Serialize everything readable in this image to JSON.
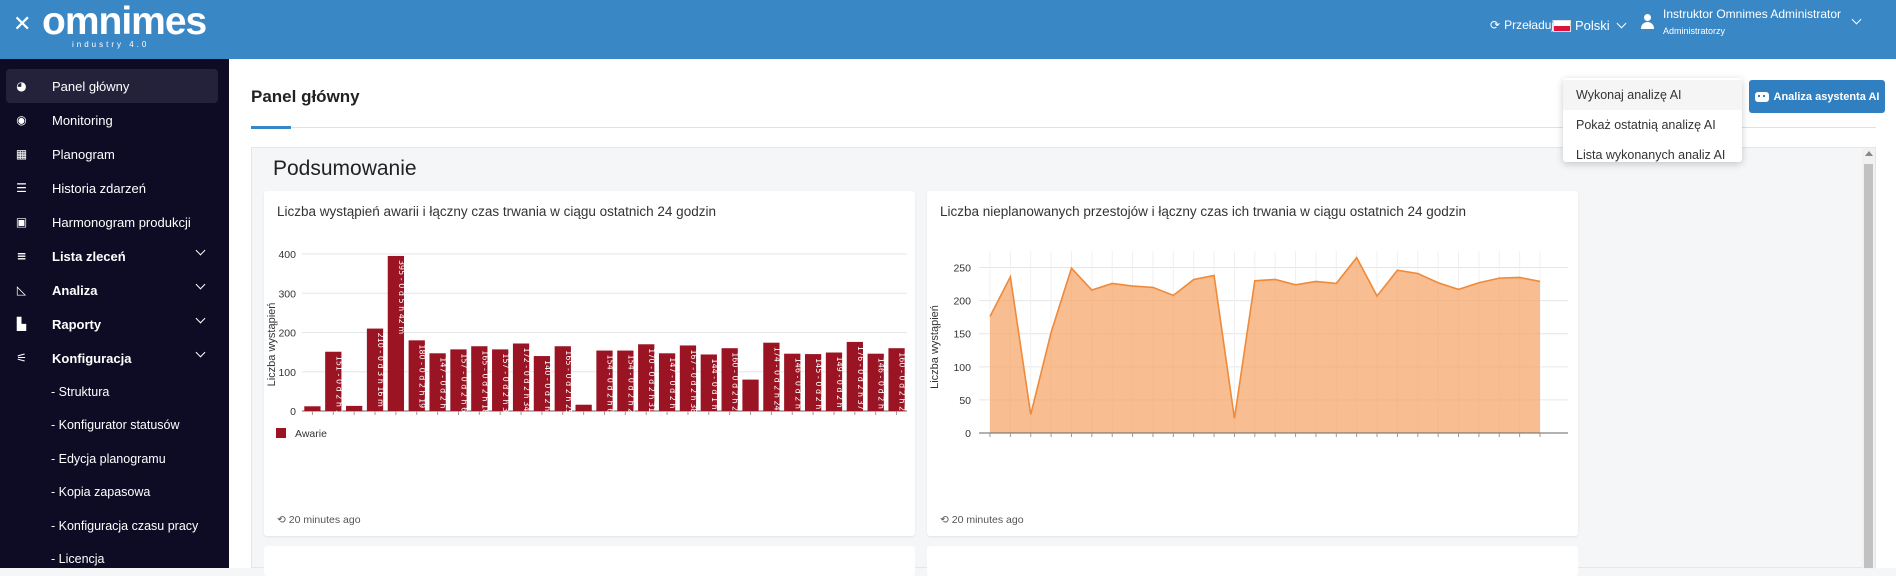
{
  "header": {
    "close_icon": "close-icon",
    "logo": "omnimes",
    "logo_tagline": "industry 4.0",
    "reload_label": "Przeładuj",
    "language": "Polski",
    "user_name": "Instruktor Omnimes Administrator",
    "user_role": "Administratorzy",
    "color": "#3a87c6"
  },
  "sidebar": {
    "items": [
      {
        "label": "Panel główny",
        "icon": "dashboard-icon"
      },
      {
        "label": "Monitoring",
        "icon": "eye-icon"
      },
      {
        "label": "Planogram",
        "icon": "map-icon"
      },
      {
        "label": "Historia zdarzeń",
        "icon": "list-icon"
      },
      {
        "label": "Harmonogram produkcji",
        "icon": "calendar-icon"
      },
      {
        "label": "Lista zleceń",
        "icon": "task-list-icon"
      },
      {
        "label": "Analiza",
        "icon": "area-chart-icon"
      },
      {
        "label": "Raporty",
        "icon": "bar-chart-icon"
      },
      {
        "label": "Konfiguracja",
        "icon": "sliders-icon"
      }
    ],
    "sub_items": [
      "- Struktura",
      "- Konfigurator statusów",
      "- Edycja planogramu",
      "- Kopia zapasowa",
      "- Konfiguracja czasu pracy",
      "- Licencja"
    ]
  },
  "main": {
    "page_title": "Panel główny",
    "ai_button": "Analiza asystenta AI",
    "dropdown": [
      "Wykonaj analizę AI",
      "Pokaż ostatnią analizę AI",
      "Lista wykonanych analiz AI"
    ],
    "panel_title": "Podsumowanie"
  },
  "cards": [
    {
      "title": "Liczba wystąpień awarii i łączny czas trwania w ciągu ostatnich 24 godzin",
      "updated": "20 minutes ago"
    },
    {
      "title": "Liczba nieplanowanych przestojów i łączny czas ich trwania w ciągu ostatnich 24 godzin",
      "updated": "20 minutes ago"
    }
  ],
  "chart_data": [
    {
      "type": "bar",
      "ylabel": "Liczba wystąpień",
      "ylim": [
        0,
        400
      ],
      "yticks": [
        0,
        100,
        200,
        300,
        400
      ],
      "grid": true,
      "legend": "bottom-left",
      "series": [
        {
          "name": "Awarie",
          "color": "#9a1424",
          "values": [
            12,
            151,
            13,
            210,
            395,
            180,
            147,
            157,
            165,
            157,
            172,
            140,
            165,
            16,
            154,
            154,
            170,
            147,
            167,
            144,
            160,
            80,
            174,
            146,
            145,
            149,
            176,
            146,
            160
          ],
          "labels": [
            "",
            "151 - 0 d 2 h 12 m",
            "",
            "210 - 0 d 3 h 16 m",
            "395 - 0 d 5 h 42 m",
            "180 - 0 d 2 h 19 m",
            "147 - 0 d 2 h 17 m",
            "157 - 0 d 2 h 6 m",
            "165 - 0 d 2 h 18 m",
            "157 - 0 d 2 h 33 m",
            "172 - 0 d 2 h 34 m",
            "140 - 0 d 2 h 2 m",
            "165 - 0 d 2 h 25 m",
            "",
            "154 - 0 d 2 h 6 m",
            "154 - 0 d 2 h 20 m",
            "170 - 0 d 2 h 31 m",
            "147 - 0 d 2 h 2 m",
            "167 - 0 d 2 h 38 m",
            "144 - 0 d 1 h 59 m",
            "160 - 0 d 2 h 26 m",
            "",
            "174 - 0 d 2 h 24 m",
            "146 - 0 d 2 h 16 m",
            "145 - 0 d 2 h 13 m",
            "149 - 0 d 2 h 16 m",
            "176 - 0 d 2 h 37 m",
            "146 - 0 d 2 h 5 m",
            "160 - 0 d 2 h 22 m"
          ]
        }
      ]
    },
    {
      "type": "area",
      "ylabel": "Liczba wystąpień",
      "ylim": [
        0,
        275
      ],
      "yticks": [
        0,
        50,
        100,
        150,
        200,
        250
      ],
      "grid": true,
      "series": [
        {
          "color": "#f5a76b",
          "values": [
            176,
            236,
            28,
            152,
            249,
            216,
            226,
            222,
            220,
            208,
            232,
            238,
            22,
            230,
            232,
            224,
            229,
            226,
            265,
            207,
            246,
            241,
            227,
            217,
            227,
            234,
            235,
            229
          ]
        }
      ]
    }
  ]
}
